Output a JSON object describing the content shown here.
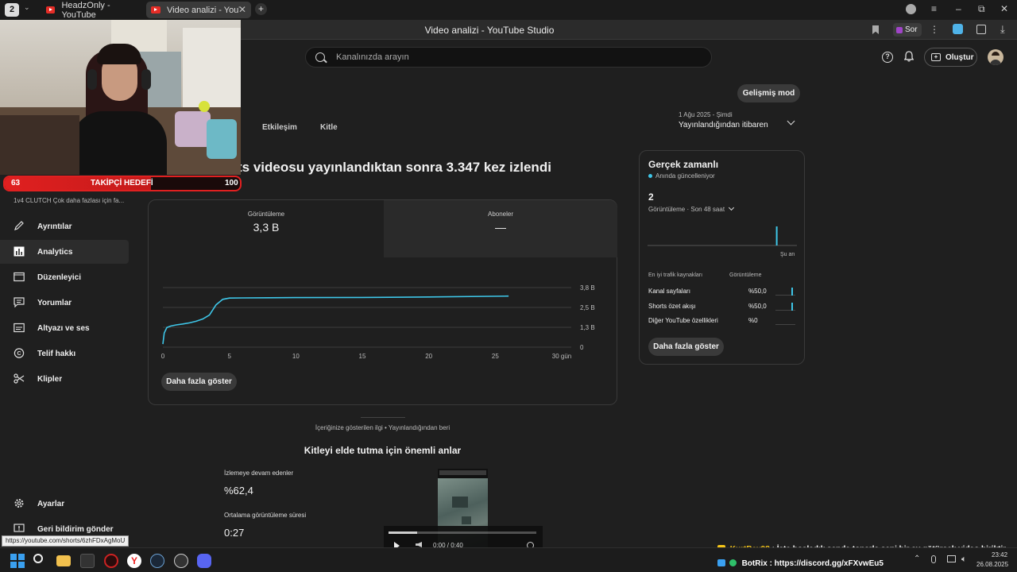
{
  "browser": {
    "tab_count": "2",
    "tabs": [
      {
        "label": "HeadzOnly - YouTube"
      },
      {
        "label": "Video analizi - YouTube ..."
      }
    ],
    "page_title": "Video analizi - YouTube Studio",
    "sor_label": "Sor"
  },
  "header": {
    "search_placeholder": "Kanalınızda arayın",
    "create_label": "Oluştur"
  },
  "advanced_mode": "Gelişmiş mod",
  "tabs": [
    {
      "label": "Etkileşim"
    },
    {
      "label": "Kitle"
    }
  ],
  "date_range": {
    "range": "1 Ağu 2025 - Şimdi",
    "label": "Yayınlandığından itibaren"
  },
  "headline": "orts videosu yayınlandıktan sonra 3.347 kez izlendi",
  "metrics": [
    {
      "label": "Görüntüleme",
      "value": "3,3 B"
    },
    {
      "label": "Aboneler",
      "value": "—"
    }
  ],
  "chart_data": {
    "type": "line",
    "x_ticks": [
      "0",
      "5",
      "10",
      "15",
      "20",
      "25",
      "30 gün"
    ],
    "y_ticks": [
      "3,8 B",
      "2,5 B",
      "1,3 B",
      "0"
    ],
    "ylim": [
      0,
      3800
    ],
    "xlim": [
      0,
      30
    ],
    "line_color": "#3ec6e8",
    "series": [
      {
        "x": [
          0,
          0.1,
          0.3,
          0.6,
          1,
          1.5,
          2,
          2.5,
          3,
          3.5,
          4,
          4.5,
          5,
          6,
          8,
          10,
          15,
          20,
          26
        ],
        "y": [
          200,
          900,
          1250,
          1350,
          1420,
          1480,
          1550,
          1650,
          1800,
          2050,
          2700,
          3050,
          3130,
          3140,
          3150,
          3160,
          3170,
          3200,
          3260
        ]
      }
    ]
  },
  "show_more": "Daha fazla göster",
  "retention": {
    "caption": "İçeriğinize gösterilen ilgi • Yayınlandığından beri",
    "title": "Kitleyi elde tutma için önemli anlar",
    "stayed_label": "İzlemeye devam edenler",
    "stayed_value": "%62,4",
    "avg_label": "Ortalama görüntüleme süresi",
    "avg_value": "0:27",
    "player_time": "0:00 / 0:40"
  },
  "realtime": {
    "title": "Gerçek zamanlı",
    "live_label": "Anında güncelleniyor",
    "count": "2",
    "count_label": "Görüntüleme · Son 48 saat",
    "now_label": "Şu an",
    "bar_values": [
      0,
      0,
      0,
      0,
      0,
      0,
      0,
      0,
      0,
      0,
      0,
      0,
      0,
      0,
      0,
      0,
      0,
      0,
      0,
      0,
      0,
      0,
      0,
      0,
      0,
      0,
      0,
      0,
      0,
      0,
      0,
      0,
      0,
      0,
      0,
      0,
      0,
      0,
      0,
      0,
      0,
      2,
      0,
      0,
      0,
      0,
      0,
      0
    ],
    "sources_header": "En iyi trafik kaynakları",
    "views_header": "Görüntüleme",
    "sources": [
      {
        "name": "Kanal sayfaları",
        "value": "%50,0",
        "share": 0.5
      },
      {
        "name": "Shorts özet akışı",
        "value": "%50,0",
        "share": 0.5
      },
      {
        "name": "Diğer YouTube özellikleri",
        "value": "%0",
        "share": 0
      }
    ],
    "show_more": "Daha fazla göster"
  },
  "nav": {
    "subtitle": "1v4 CLUTCH Çok daha fazlası için fa...",
    "items": [
      {
        "label": "Ayrıntılar"
      },
      {
        "label": "Analytics"
      },
      {
        "label": "Düzenleyici"
      },
      {
        "label": "Yorumlar"
      },
      {
        "label": "Altyazı ve ses"
      },
      {
        "label": "Telif hakkı"
      },
      {
        "label": "Klipler"
      }
    ],
    "settings": "Ayarlar",
    "feedback": "Geri bildirim gönder"
  },
  "status_url": "https://youtube.com/shorts/6zhFDxAgMoU",
  "goal": {
    "current": "63",
    "label": "TAKİPÇİ HEDEFİ",
    "target": "100"
  },
  "chat": [
    {
      "user": "KurtBey98",
      "message": ": İşte boşladık sende toparla seni bir ay götürcek video biriktir"
    },
    {
      "user": "BotRix",
      "message": ": https://discord.gg/xFXvwEu5"
    }
  ],
  "clock": {
    "time": "23:42",
    "date": "26.08.2025"
  },
  "colors": {
    "accent": "#3ec6e8",
    "bg": "#1f1f1f",
    "goal_red": "#e02020",
    "youtube_red": "#e52d27"
  }
}
